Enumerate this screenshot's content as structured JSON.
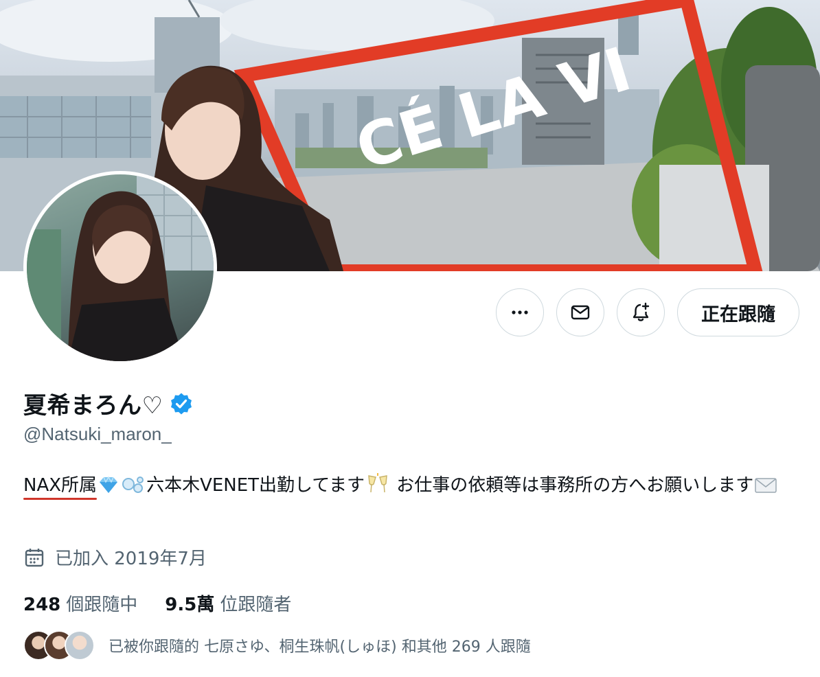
{
  "banner": {
    "sign_text": "CÉ LA VI"
  },
  "actions": {
    "follow_label": "正在跟隨"
  },
  "profile": {
    "display_name": "夏希まろん♡",
    "handle": "@Natsuki_maron_",
    "verified": true,
    "accent_color": "#1d9bf0"
  },
  "bio": {
    "part1": "NAX所属",
    "part2": "六本木VENET出勤してます",
    "part3": " お仕事の依頼等は事務所の方へお願いします"
  },
  "joined": {
    "text": "已加入 2019年7月",
    "icon": "calendar-icon"
  },
  "stats": {
    "following_count": "248",
    "following_label": "個跟隨中",
    "followers_count": "9.5萬",
    "followers_label": "位跟隨者"
  },
  "followed_by": {
    "text": "已被你跟隨的 七原さゆ、桐生珠帆(しゅほ) 和其他 269 人跟隨"
  }
}
